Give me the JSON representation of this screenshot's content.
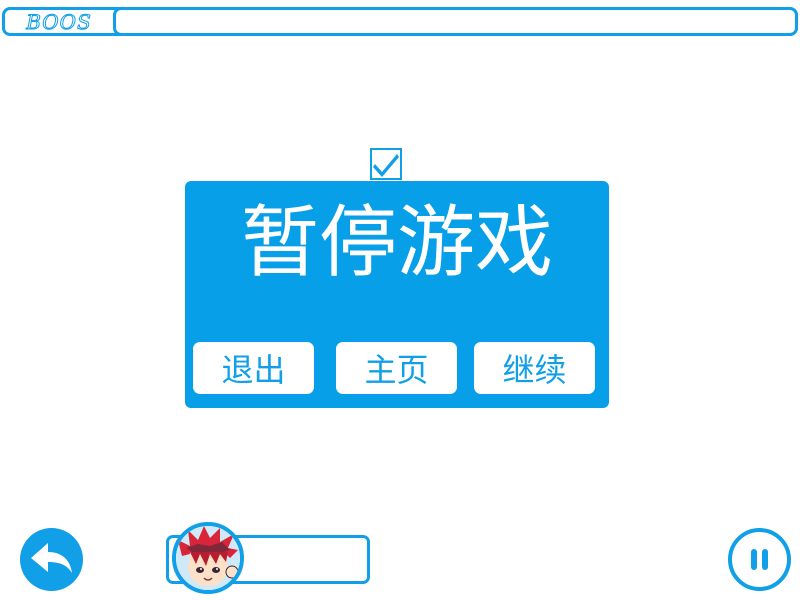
{
  "colors": {
    "accent": "#119fe8",
    "dialog_bg": "#069fe8",
    "background": "#ffffff",
    "text_on_accent": "#ffffff"
  },
  "boss": {
    "label": "BOOS",
    "hp_fraction": 0
  },
  "checkbox": {
    "checked": true,
    "icon": "checkmark-icon"
  },
  "pause_dialog": {
    "title": "暂停游戏",
    "buttons": {
      "exit": "退出",
      "home": "主页",
      "continue": "继续"
    }
  },
  "player": {
    "hp_fraction": 0,
    "avatar": "red-spiky-haired-anime-character"
  },
  "controls": {
    "back_icon": "reply-arrow-icon",
    "pause_icon": "pause-icon"
  }
}
